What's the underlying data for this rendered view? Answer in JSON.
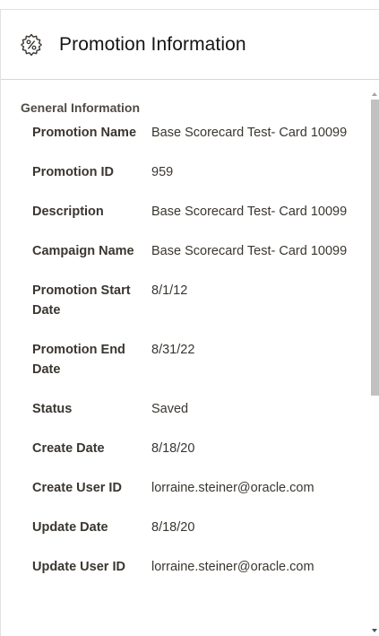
{
  "header": {
    "title": "Promotion Information",
    "icon": "percent-gear-icon"
  },
  "section": {
    "title": "General Information"
  },
  "rows": [
    {
      "label": "Promotion Name",
      "value": "Base Scorecard Test- Card 10099"
    },
    {
      "label": "Promotion ID",
      "value": "959"
    },
    {
      "label": "Description",
      "value": "Base Scorecard Test- Card 10099"
    },
    {
      "label": "Campaign Name",
      "value": "Base Scorecard Test- Card 10099"
    },
    {
      "label": "Promotion Start Date",
      "value": "8/1/12"
    },
    {
      "label": "Promotion End Date",
      "value": "8/31/22"
    },
    {
      "label": "Status",
      "value": "Saved"
    },
    {
      "label": "Create Date",
      "value": "8/18/20"
    },
    {
      "label": "Create User ID",
      "value": "lorraine.steiner@oracle.com"
    },
    {
      "label": "Update Date",
      "value": "8/18/20"
    },
    {
      "label": "Update User ID",
      "value": "lorraine.steiner@oracle.com"
    }
  ]
}
